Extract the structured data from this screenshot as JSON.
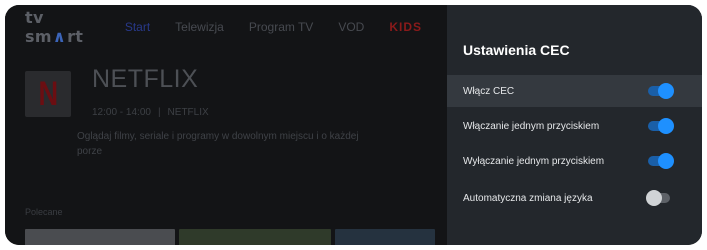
{
  "nav": {
    "logo": {
      "left": "tv sm",
      "mark": "∧",
      "right": "rt"
    },
    "items": [
      {
        "label": "Start",
        "active": true
      },
      {
        "label": "Telewizja"
      },
      {
        "label": "Program TV"
      },
      {
        "label": "VOD"
      },
      {
        "label": "KIDS"
      }
    ]
  },
  "featured": {
    "logo_letter": "N",
    "title": "NETFLIX",
    "time": "12:00 - 14:00",
    "channel": "NETFLIX",
    "description": "Oglądaj filmy, seriale i programy w dowolnym miejscu i o każdej porze"
  },
  "section_title": "Polecane",
  "panel": {
    "title": "Ustawienia CEC",
    "items": [
      {
        "label": "Włącz CEC",
        "enabled": true,
        "focused": true
      },
      {
        "label": "Włączanie jednym przyciskiem",
        "enabled": true
      },
      {
        "label": "Wyłączanie jednym przyciskiem",
        "enabled": true
      },
      {
        "label": "Automatyczna zmiana języka",
        "enabled": false
      }
    ]
  },
  "colors": {
    "toggle_on": "#1e90ff",
    "toggle_off": "#d0d3d6",
    "panel_bg": "#23272c"
  }
}
